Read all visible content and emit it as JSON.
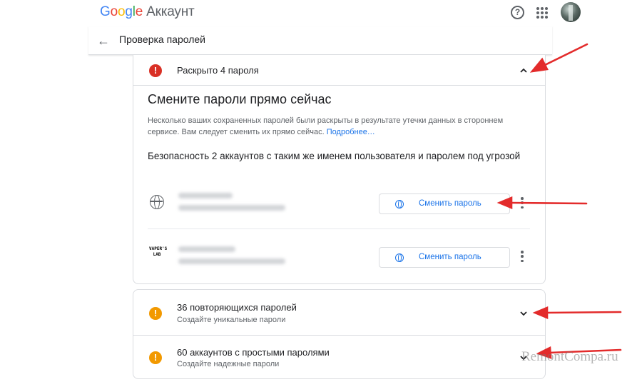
{
  "header": {
    "logo_letters": [
      {
        "char": "G",
        "color": "#4285f4"
      },
      {
        "char": "o",
        "color": "#ea4335"
      },
      {
        "char": "o",
        "color": "#fbbc05"
      },
      {
        "char": "g",
        "color": "#4285f4"
      },
      {
        "char": "l",
        "color": "#34a853"
      },
      {
        "char": "e",
        "color": "#ea4335"
      }
    ],
    "product": "Аккаунт",
    "help_icon": "help-circle-icon",
    "apps_icon": "apps-grid-icon",
    "avatar_icon": "account-avatar"
  },
  "subheader": {
    "back_icon": "arrow-back-icon",
    "title": "Проверка паролей"
  },
  "compromised": {
    "status_icon": "error-icon",
    "status_color": "#d93025",
    "heading": "Раскрыто 4 пароля",
    "expanded_icon": "chevron-up-icon",
    "section_title": "Смените пароли прямо сейчас",
    "description": "Несколько ваших сохраненных паролей были раскрыты в результате утечки данных в стороннем сервисе. Вам следует сменить их прямо сейчас. ",
    "learn_more": "Подробнее…",
    "risk_text": "Безопасность 2 аккаунтов с таким же именем пользователя и паролем под угрозой",
    "accounts": [
      {
        "icon": "globe-icon",
        "button_label": "Сменить пароль",
        "more_icon": "more-vert-icon"
      },
      {
        "icon": "site-logo",
        "logo_text": "VAPER'S LAB",
        "button_label": "Сменить пароль",
        "more_icon": "more-vert-icon"
      }
    ]
  },
  "issues": [
    {
      "status_icon": "warning-icon",
      "status_color": "#f29900",
      "title": "36 повторяющихся паролей",
      "subtitle": "Создайте уникальные пароли",
      "chevron_icon": "chevron-down-icon"
    },
    {
      "status_icon": "warning-icon",
      "status_color": "#f29900",
      "title": "60 аккаунтов с простыми паролями",
      "subtitle": "Создайте надежные пароли",
      "chevron_icon": "chevron-down-icon"
    }
  ],
  "annotation_color": "#e32b2b",
  "watermark": "RemontCompa.ru"
}
